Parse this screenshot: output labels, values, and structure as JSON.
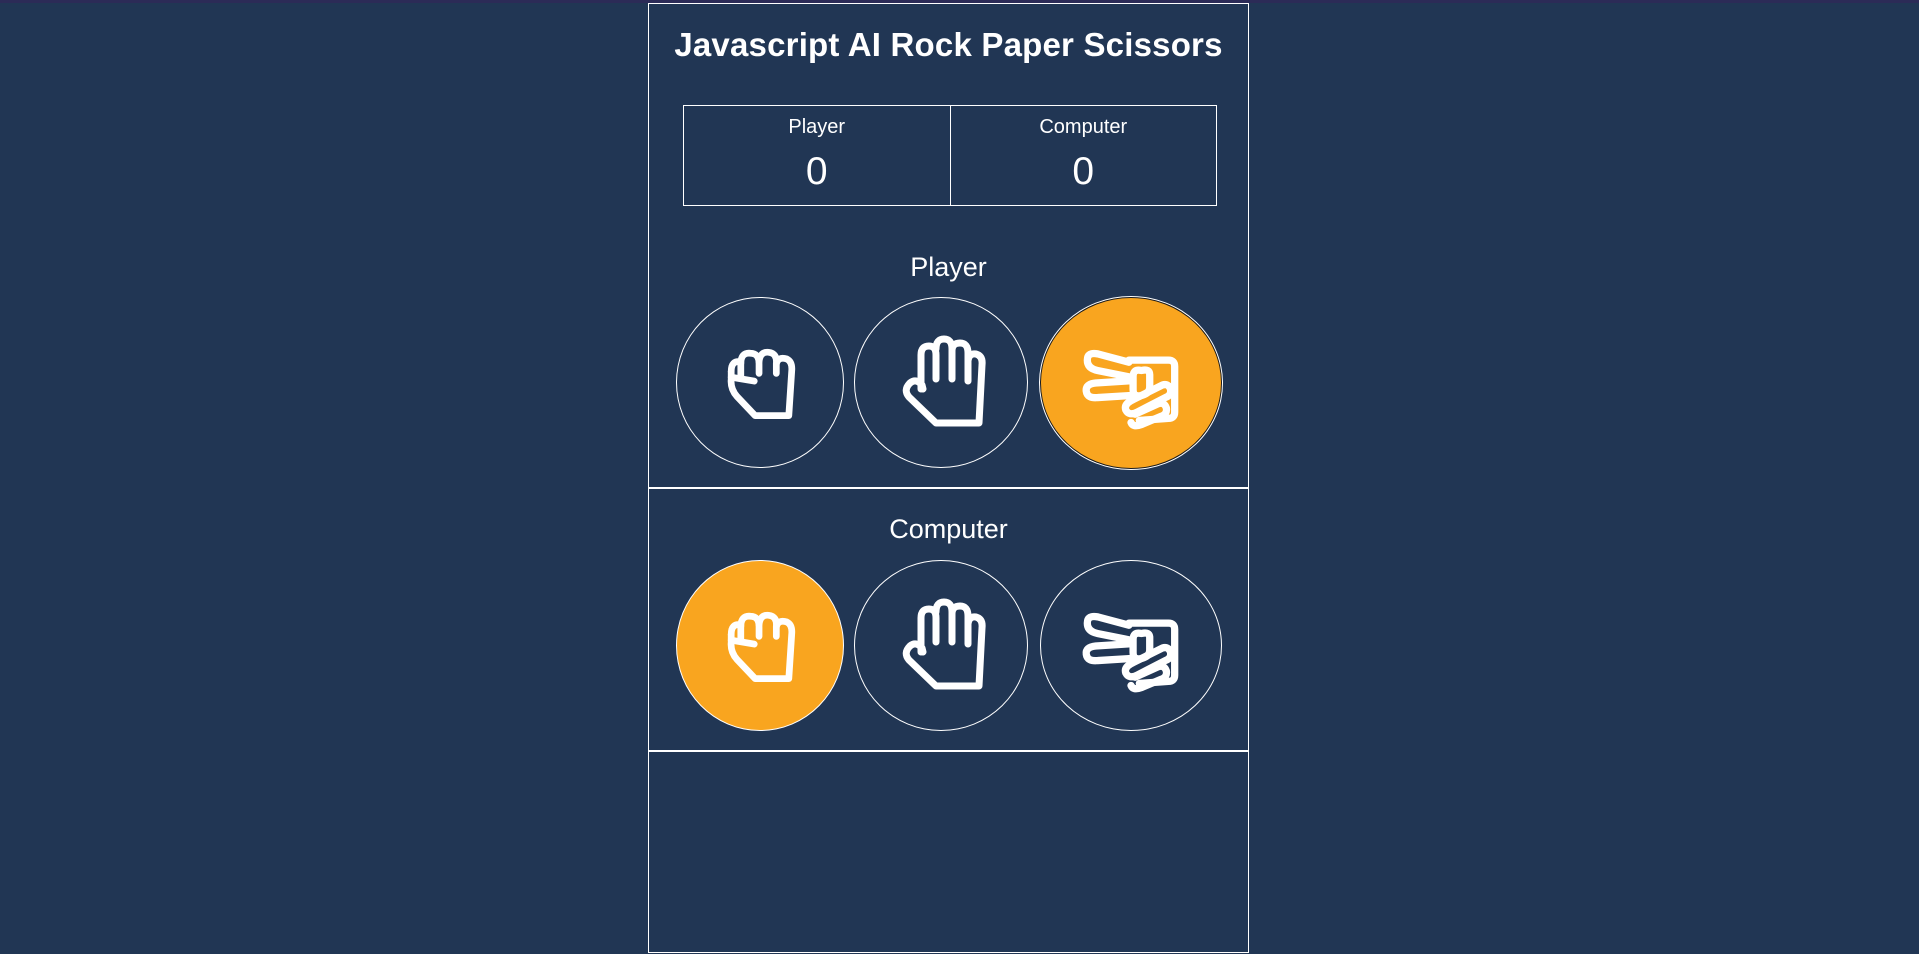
{
  "app": {
    "title": "Javascript AI Rock Paper Scissors"
  },
  "scoreboard": {
    "player": {
      "label": "Player",
      "score": "0"
    },
    "computer": {
      "label": "Computer",
      "score": "0"
    }
  },
  "player_section": {
    "title": "Player",
    "choices": [
      {
        "name": "rock",
        "icon": "rock-hand-icon",
        "selected": false
      },
      {
        "name": "paper",
        "icon": "paper-hand-icon",
        "selected": false
      },
      {
        "name": "scissors",
        "icon": "scissors-hand-icon",
        "selected": true
      }
    ]
  },
  "computer_section": {
    "title": "Computer",
    "choices": [
      {
        "name": "rock",
        "icon": "rock-hand-icon",
        "selected": true
      },
      {
        "name": "paper",
        "icon": "paper-hand-icon",
        "selected": false
      },
      {
        "name": "scissors",
        "icon": "scissors-hand-icon",
        "selected": false
      }
    ]
  },
  "colors": {
    "background": "#213654",
    "accent": "#f9a51f",
    "line": "#ffffff"
  }
}
